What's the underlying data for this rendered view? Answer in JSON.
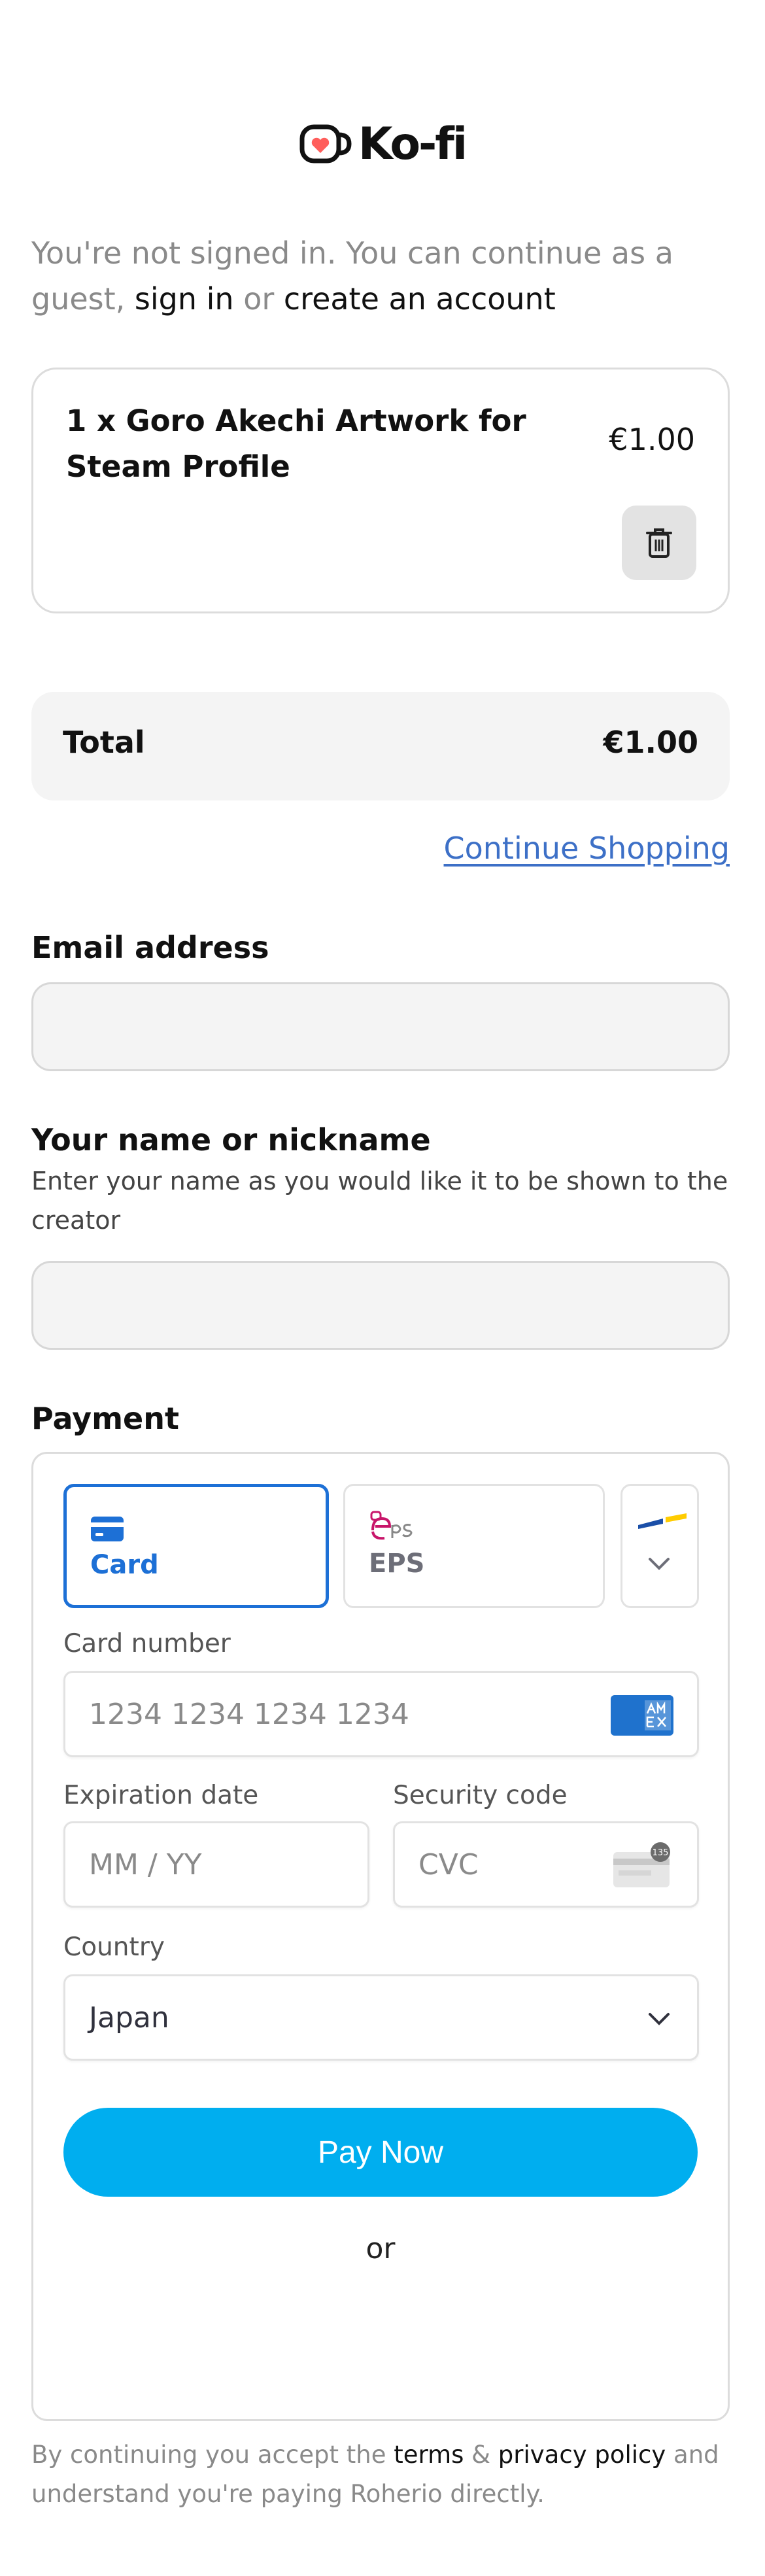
{
  "brand": {
    "name": "Ko-fi"
  },
  "signin": {
    "prefix": "You're not signed in. You can continue as a guest,",
    "sign_in": "sign in",
    "or": "or",
    "create_account": "create an account"
  },
  "cart": {
    "item_title": "1 x Goro Akechi Artwork for Steam Profile",
    "item_price": "€1.00",
    "total_label": "Total",
    "total_value": "€1.00",
    "continue_label": "Continue Shopping"
  },
  "form": {
    "email_label": "Email address",
    "email_value": "",
    "name_label": "Your name or nickname",
    "name_hint": "Enter your name as you would like it to be shown to the creator",
    "name_value": ""
  },
  "payment": {
    "heading": "Payment",
    "tabs": [
      {
        "label": "Card",
        "icon": "card-icon",
        "selected": true
      },
      {
        "label": "EPS",
        "icon": "eps-logo-icon",
        "selected": false
      }
    ],
    "card_number_label": "Card number",
    "card_number_placeholder": "1234 1234 1234 1234",
    "expiry_label": "Expiration date",
    "expiry_placeholder": "MM / YY",
    "cvc_label": "Security code",
    "cvc_placeholder": "CVC",
    "country_label": "Country",
    "country_value": "Japan",
    "pay_button": "Pay Now",
    "or_text": "or"
  },
  "footer": {
    "prefix": "By continuing you accept the",
    "terms": "terms",
    "amp": "&",
    "privacy": "privacy policy",
    "suffix": "and understand you're paying Roherio directly."
  },
  "colors": {
    "accent": "#00aeef",
    "link": "#3d70c7",
    "selected_tab": "#1d70d6",
    "brand_red": "#ff5e5b"
  }
}
